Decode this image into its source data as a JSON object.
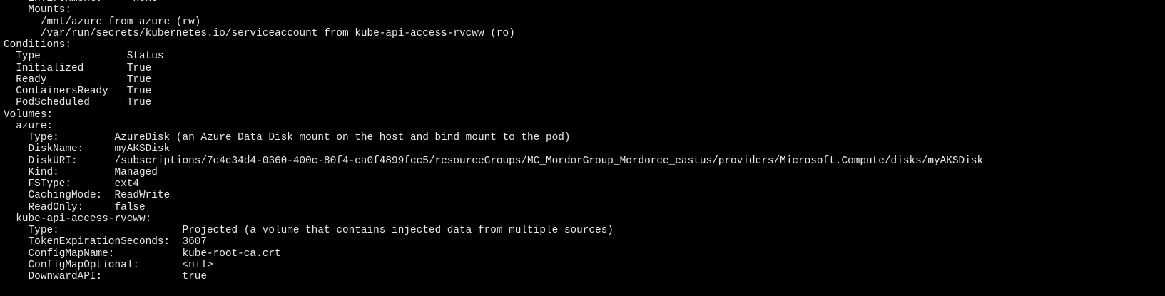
{
  "terminal": {
    "lines": [
      "    Environment:    <none>",
      "    Mounts:",
      "      /mnt/azure from azure (rw)",
      "      /var/run/secrets/kubernetes.io/serviceaccount from kube-api-access-rvcww (ro)",
      "Conditions:",
      "  Type              Status",
      "  Initialized       True",
      "  Ready             True",
      "  ContainersReady   True",
      "  PodScheduled      True",
      "Volumes:",
      "  azure:",
      "    Type:         AzureDisk (an Azure Data Disk mount on the host and bind mount to the pod)",
      "    DiskName:     myAKSDisk",
      "    DiskURI:      /subscriptions/7c4c34d4-0360-400c-80f4-ca0f4899fcc5/resourceGroups/MC_MordorGroup_Mordorce_eastus/providers/Microsoft.Compute/disks/myAKSDisk",
      "    Kind:         Managed",
      "    FSType:       ext4",
      "    CachingMode:  ReadWrite",
      "    ReadOnly:     false",
      "  kube-api-access-rvcww:",
      "    Type:                    Projected (a volume that contains injected data from multiple sources)",
      "    TokenExpirationSeconds:  3607",
      "    ConfigMapName:           kube-root-ca.crt",
      "    ConfigMapOptional:       <nil>",
      "    DownwardAPI:             true"
    ]
  }
}
